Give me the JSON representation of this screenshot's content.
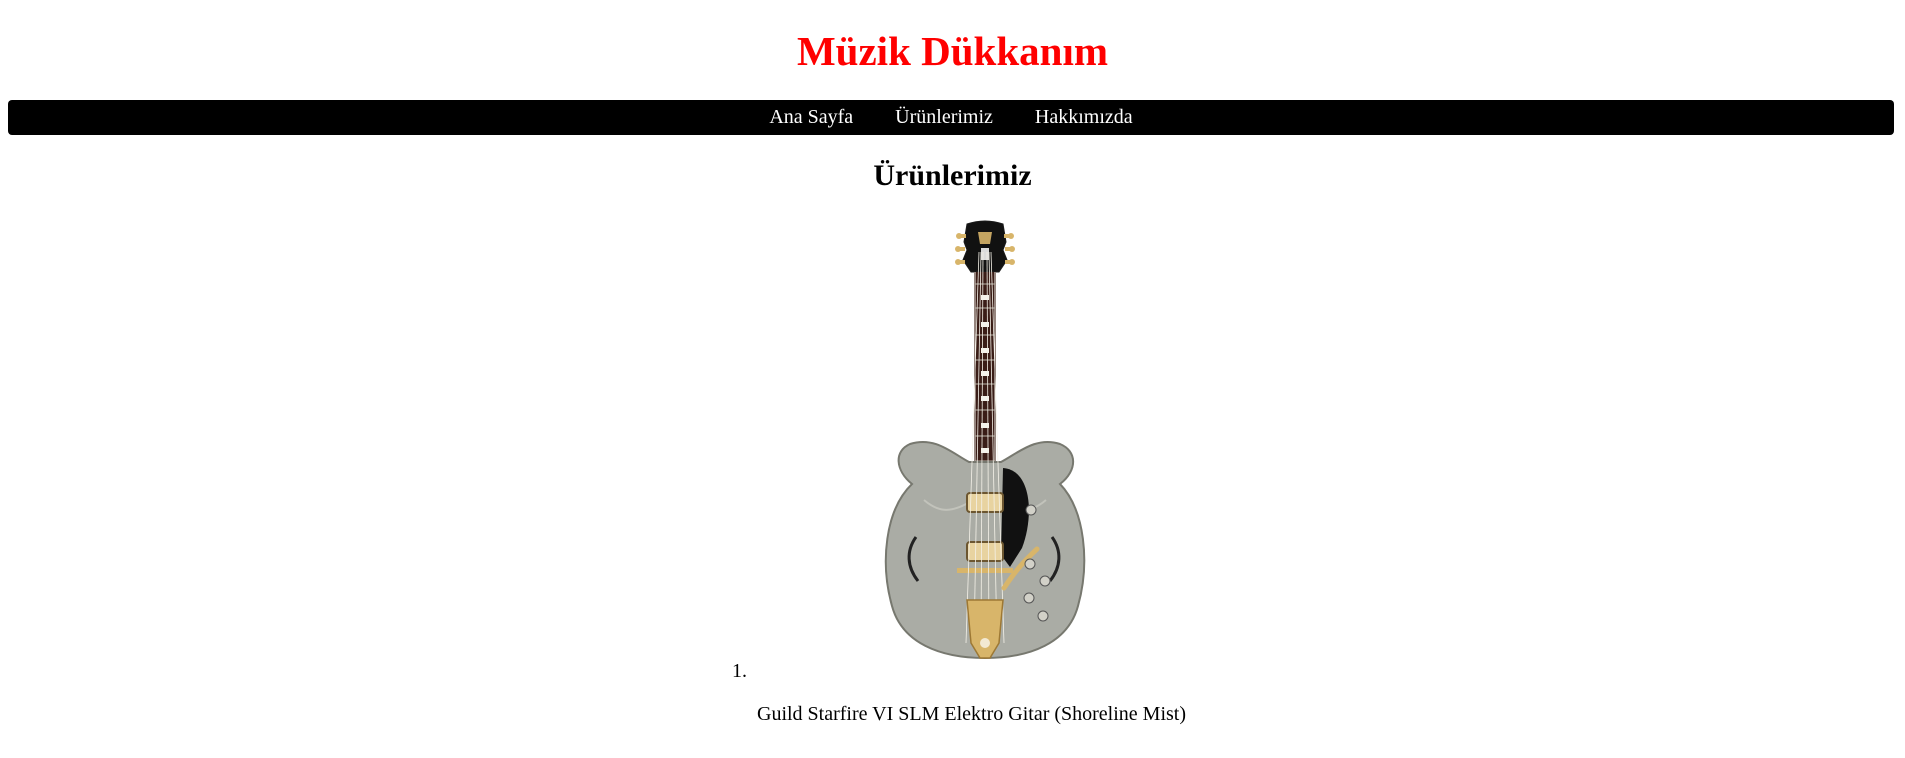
{
  "header": {
    "site_title": "Müzik Dükkanım"
  },
  "nav": {
    "items": [
      {
        "label": "Ana Sayfa"
      },
      {
        "label": "Ürünlerimiz"
      },
      {
        "label": "Hakkımızda"
      }
    ]
  },
  "main": {
    "section_title": "Ürünlerimiz",
    "products": [
      {
        "number": "1.",
        "name": "Guild Starfire VI SLM Elektro Gitar (Shoreline Mist)",
        "image": "guitar-image"
      }
    ]
  },
  "colors": {
    "title": "#ff0000",
    "nav_bg": "#000000",
    "nav_text": "#ffffff",
    "guitar_body": "#a9aba4",
    "guitar_hardware": "#d8b56a"
  }
}
